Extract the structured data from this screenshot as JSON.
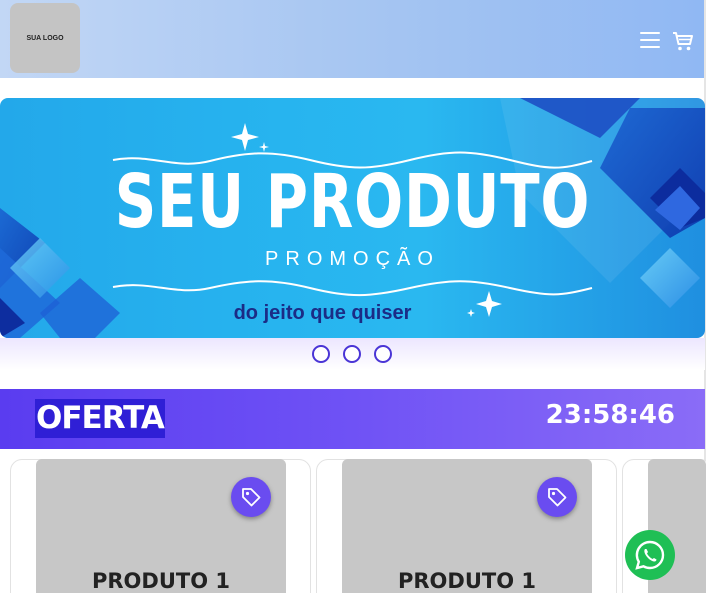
{
  "header": {
    "logo_text": "SUA LOGO",
    "menu_icon": "hamburger-menu-icon",
    "cart_icon": "shopping-cart-icon"
  },
  "banner": {
    "title": "SEU PRODUTO",
    "subtitle": "PROMOÇÃO",
    "tagline": "do jeito que quiser",
    "colors": {
      "background": "#27b4ef",
      "accent": "#1b2c86"
    }
  },
  "carousel": {
    "dot_count": 3
  },
  "offer": {
    "label": "OFERTA",
    "countdown": "23:58:46",
    "colors": {
      "bar": "#6f52f5",
      "label_bg": "#2f1fd6"
    }
  },
  "products": [
    {
      "name": "PRODUTO 1",
      "icon": "price-tag-icon"
    },
    {
      "name": "PRODUTO 1",
      "icon": "price-tag-icon"
    }
  ],
  "floating": {
    "whatsapp_icon": "whatsapp-icon"
  }
}
